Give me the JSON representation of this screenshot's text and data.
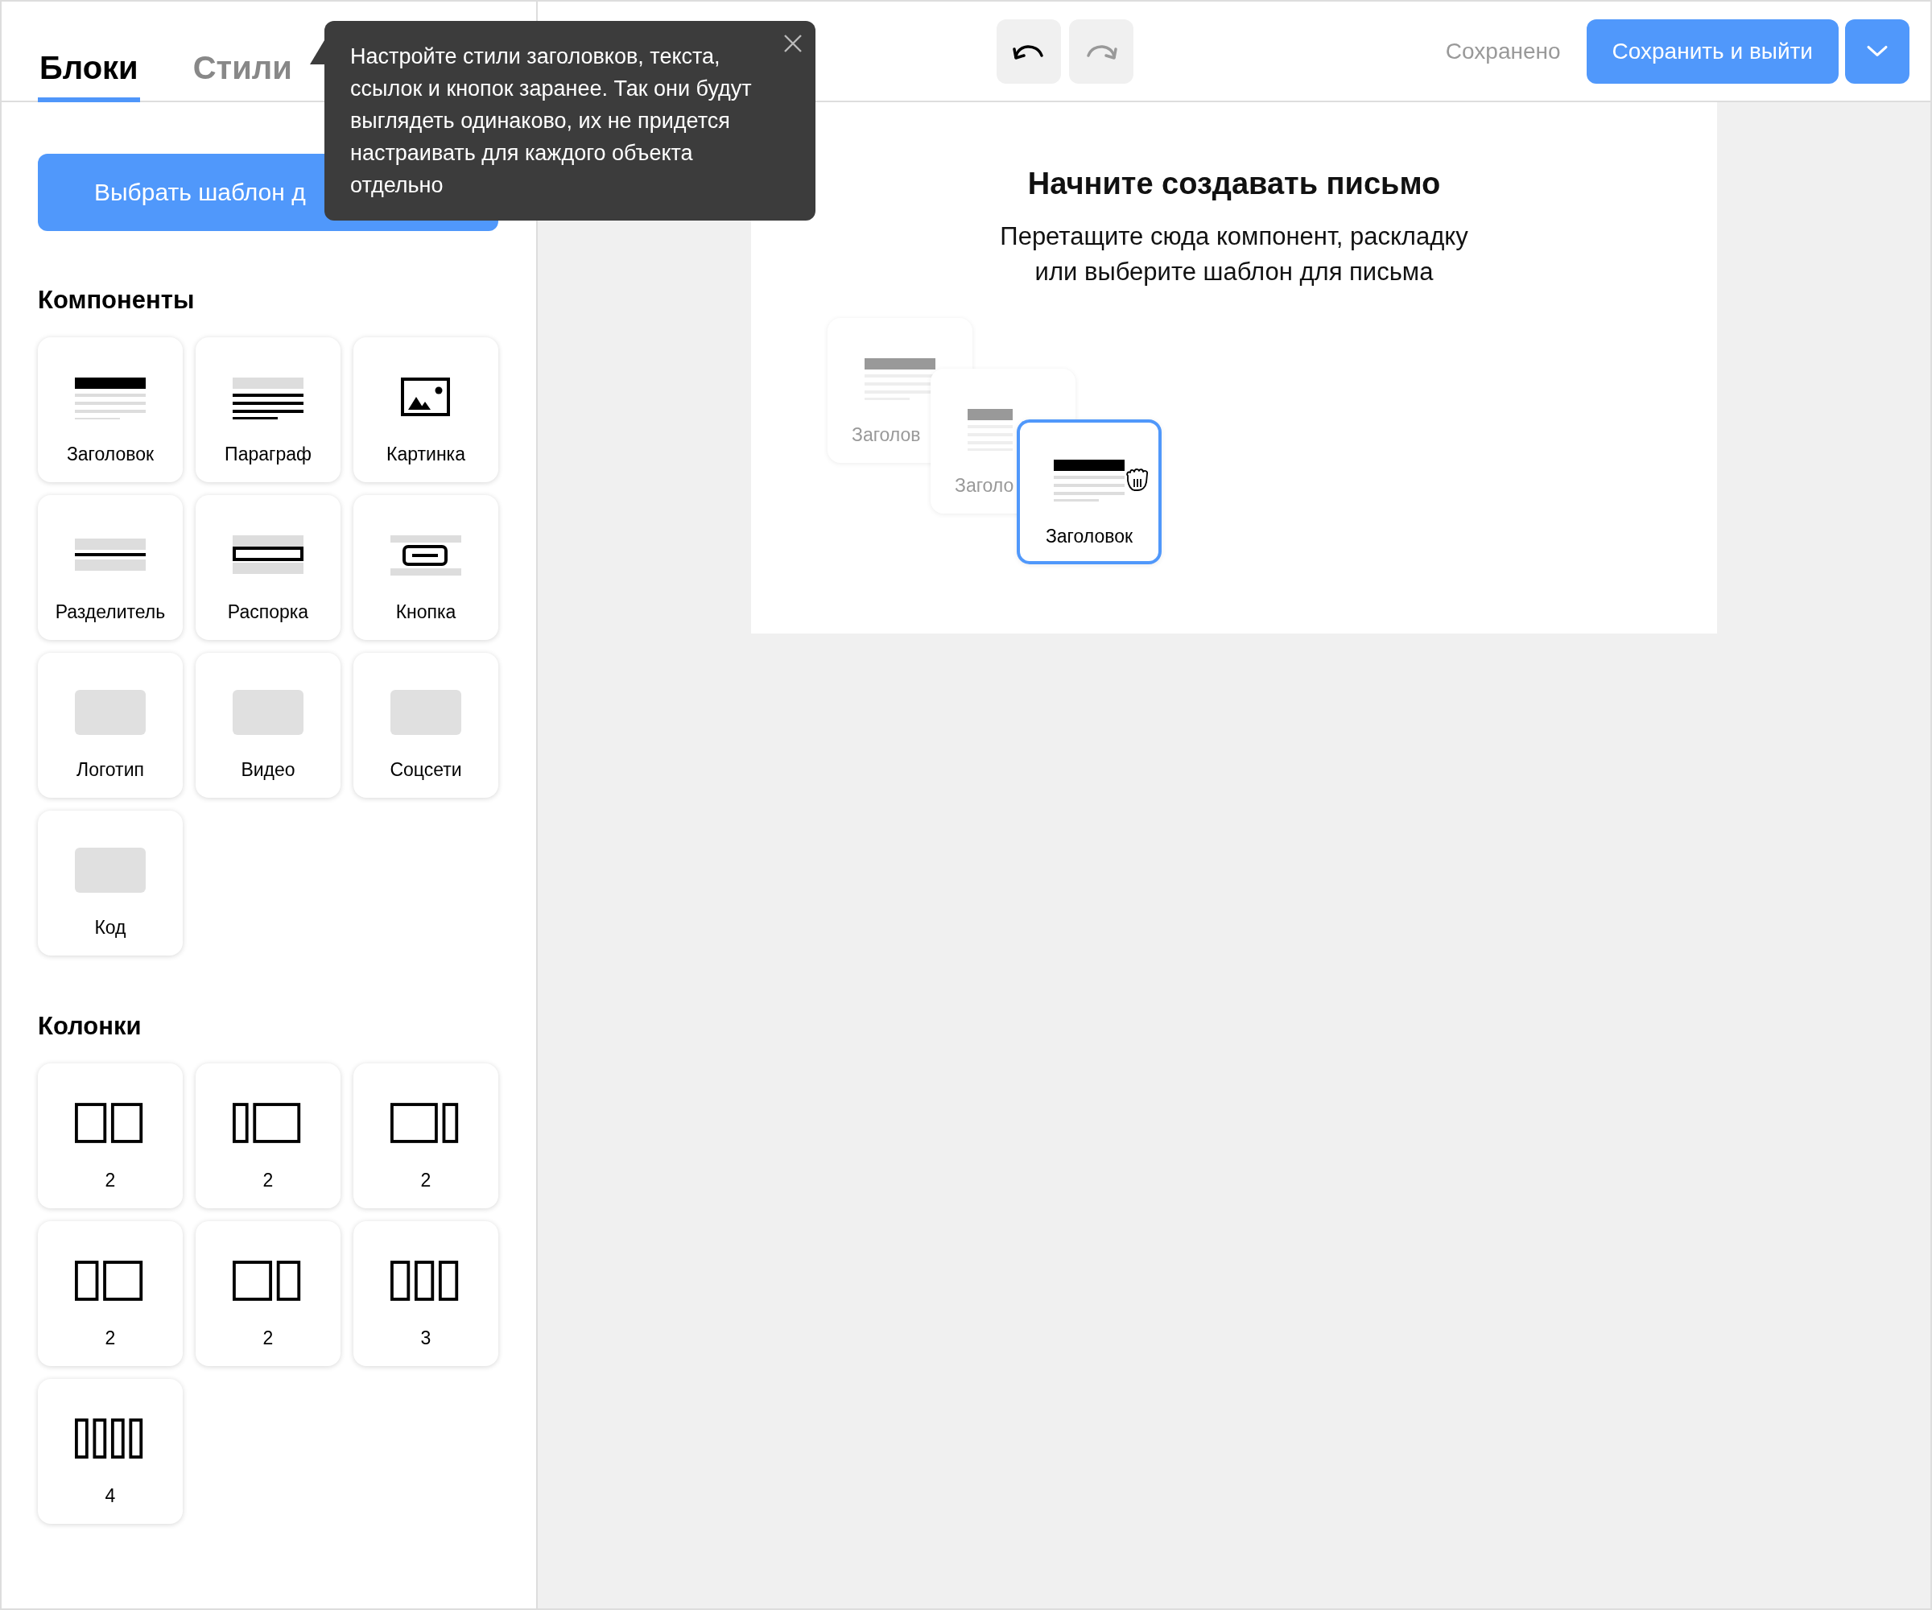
{
  "tabs": [
    {
      "label": "Блоки",
      "selected": true
    },
    {
      "label": "Стили",
      "selected": false
    }
  ],
  "template_button": "Выбрать шаблон д",
  "components": {
    "title": "Компоненты",
    "items": [
      {
        "label": "Заголовок",
        "kind": "heading"
      },
      {
        "label": "Параграф",
        "kind": "paragraph"
      },
      {
        "label": "Картинка",
        "kind": "image"
      },
      {
        "label": "Разделитель",
        "kind": "divider"
      },
      {
        "label": "Распорка",
        "kind": "spacer"
      },
      {
        "label": "Кнопка",
        "kind": "button"
      },
      {
        "label": "Логотип",
        "kind": "placeholder"
      },
      {
        "label": "Видео",
        "kind": "placeholder"
      },
      {
        "label": "Соцсети",
        "kind": "placeholder"
      },
      {
        "label": "Код",
        "kind": "placeholder"
      }
    ]
  },
  "columns": {
    "title": "Колонки",
    "items": [
      {
        "label": "2",
        "kind": "equal"
      },
      {
        "label": "2",
        "kind": "narrow-left"
      },
      {
        "label": "2",
        "kind": "narrow-right"
      },
      {
        "label": "2",
        "kind": "smaller-left"
      },
      {
        "label": "2",
        "kind": "smaller-right"
      },
      {
        "label": "3",
        "kind": "three"
      },
      {
        "label": "4",
        "kind": "four"
      }
    ]
  },
  "history": [
    {
      "kind": "undo",
      "disabled": false
    },
    {
      "kind": "redo",
      "disabled": true
    }
  ],
  "save_status": "Сохранено",
  "save_button": "Сохранить и выйти",
  "tooltip": {
    "text": "Настройте стили заголовков, текста, ссылок и кнопок заранее. Так они будут выглядеть одинаково, их не придется настраивать для каждого объекта отдельно"
  },
  "canvas": {
    "title": "Начните создавать письмо",
    "subtitle_lines": [
      "Перетащите сюда компонент, раскладку",
      "или выберите шаблон для письма"
    ],
    "drag_cards": [
      {
        "label": "Заголов",
        "selected": false
      },
      {
        "label": "Заголо",
        "selected": false
      },
      {
        "label": "Заголовок",
        "selected": true
      }
    ]
  }
}
